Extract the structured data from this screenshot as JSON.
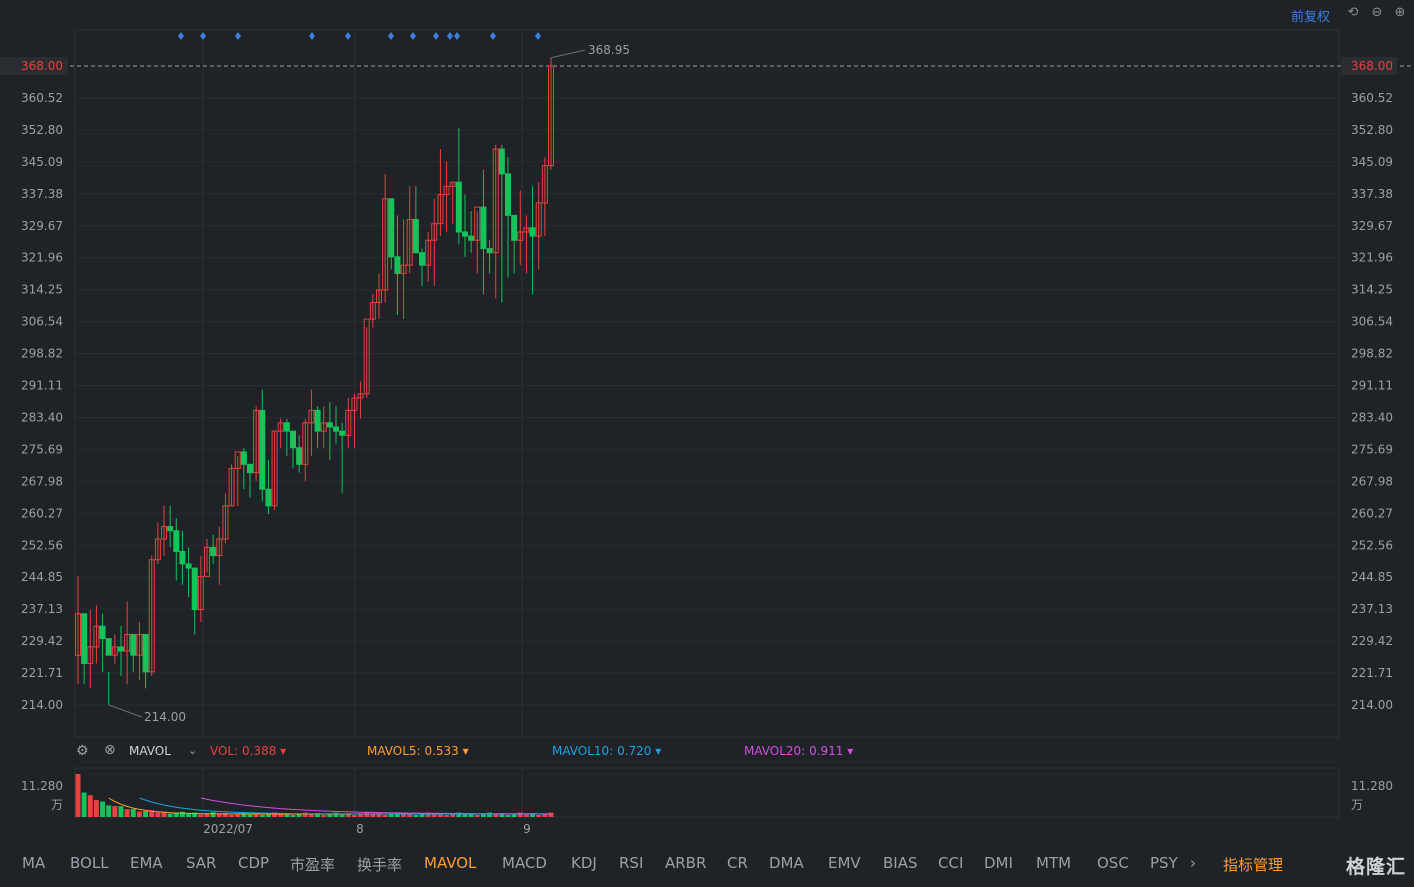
{
  "header": {
    "rehab_label": "前复权",
    "icons": [
      "reset-icon",
      "zoom-out-icon",
      "zoom-in-icon"
    ]
  },
  "price_chart": {
    "price_ticks": [
      "368.00",
      "360.52",
      "352.80",
      "345.09",
      "337.38",
      "329.67",
      "321.96",
      "314.25",
      "306.54",
      "298.82",
      "291.11",
      "283.40",
      "275.69",
      "267.98",
      "260.27",
      "252.56",
      "244.85",
      "237.13",
      "229.42",
      "221.71",
      "214.00"
    ],
    "current_price": "368.00",
    "high_label": "368.95",
    "low_label": "214.00",
    "date_labels": [
      "2022/07",
      "8",
      "9"
    ],
    "colors": {
      "up": "#e8423f",
      "down": "#16c25a",
      "current": "#e8423f",
      "marker": "#3d7fe0"
    },
    "candles": [
      [
        226,
        245,
        219,
        236
      ],
      [
        236,
        232,
        219,
        224
      ],
      [
        224,
        237,
        218,
        228
      ],
      [
        228,
        238,
        224,
        233
      ],
      [
        233,
        236,
        222,
        230
      ],
      [
        230,
        222,
        214,
        226
      ],
      [
        226,
        231,
        224,
        228
      ],
      [
        228,
        233,
        221,
        227
      ],
      [
        227,
        239,
        219,
        231
      ],
      [
        231,
        228,
        222,
        226
      ],
      [
        226,
        234,
        220,
        231
      ],
      [
        231,
        222,
        218,
        222
      ],
      [
        222,
        250,
        221,
        249
      ],
      [
        249,
        258,
        248,
        254
      ],
      [
        254,
        262,
        250,
        257
      ],
      [
        257,
        262,
        252,
        256
      ],
      [
        256,
        259,
        244,
        251
      ],
      [
        251,
        256,
        243,
        248
      ],
      [
        248,
        252,
        240,
        247
      ],
      [
        247,
        241,
        231,
        237
      ],
      [
        237,
        250,
        234,
        245
      ],
      [
        245,
        254,
        246,
        252
      ],
      [
        252,
        255,
        248,
        250
      ],
      [
        250,
        257,
        243,
        254
      ],
      [
        254,
        265,
        253,
        262
      ],
      [
        262,
        272,
        262,
        271
      ],
      [
        271,
        274,
        262,
        275
      ],
      [
        275,
        276,
        266,
        272
      ],
      [
        272,
        272,
        264,
        270
      ],
      [
        270,
        286,
        268,
        285
      ],
      [
        285,
        290,
        263,
        266
      ],
      [
        266,
        273,
        260,
        262
      ],
      [
        262,
        280,
        261,
        280
      ],
      [
        280,
        283,
        276,
        282
      ],
      [
        282,
        283,
        274,
        280
      ],
      [
        280,
        280,
        271,
        276
      ],
      [
        276,
        279,
        270,
        272
      ],
      [
        272,
        283,
        268,
        282
      ],
      [
        282,
        290,
        274,
        285
      ],
      [
        285,
        286,
        276,
        280
      ],
      [
        280,
        286,
        276,
        282
      ],
      [
        282,
        287,
        273,
        281
      ],
      [
        281,
        286,
        277,
        280
      ],
      [
        280,
        282,
        265,
        279
      ],
      [
        279,
        288,
        276,
        285
      ],
      [
        285,
        289,
        276,
        288
      ],
      [
        288,
        292,
        283,
        289
      ],
      [
        289,
        305,
        288,
        307
      ],
      [
        307,
        313,
        305,
        311
      ],
      [
        311,
        318,
        307,
        314
      ],
      [
        314,
        342,
        311,
        336
      ],
      [
        336,
        335,
        319,
        322
      ],
      [
        322,
        332,
        308,
        318
      ],
      [
        318,
        331,
        307,
        320
      ],
      [
        320,
        339,
        318,
        331
      ],
      [
        331,
        339,
        326,
        323
      ],
      [
        323,
        324,
        315,
        320
      ],
      [
        320,
        328,
        316,
        326
      ],
      [
        326,
        336,
        315,
        330
      ],
      [
        330,
        348,
        327,
        337
      ],
      [
        337,
        345,
        328,
        339
      ],
      [
        339,
        340,
        330,
        340
      ],
      [
        340,
        353,
        325,
        328
      ],
      [
        328,
        337,
        322,
        327
      ],
      [
        327,
        333,
        323,
        326
      ],
      [
        326,
        333,
        318,
        334
      ],
      [
        334,
        343,
        313,
        324
      ],
      [
        324,
        326,
        318,
        323
      ],
      [
        323,
        349,
        312,
        348
      ],
      [
        348,
        349,
        311,
        342
      ],
      [
        342,
        346,
        317,
        332
      ],
      [
        332,
        331,
        318,
        326
      ],
      [
        326,
        338,
        320,
        328
      ],
      [
        328,
        332,
        318,
        329
      ],
      [
        329,
        339,
        313,
        327
      ],
      [
        327,
        340,
        319,
        335
      ],
      [
        335,
        346,
        327,
        344
      ],
      [
        344,
        370,
        343,
        368
      ]
    ]
  },
  "volume_panel": {
    "indicator": "MAVOL",
    "vol_label": "VOL:",
    "vol_value": "0.388",
    "ma5_label": "MAVOL5:",
    "ma5_value": "0.533",
    "ma10_label": "MAVOL10:",
    "ma10_value": "0.720",
    "ma20_label": "MAVOL20:",
    "ma20_value": "0.911",
    "max_value": "11.280",
    "unit": "万",
    "colors": {
      "vol": "#e8423f",
      "ma5": "#ff9d2e",
      "ma10": "#1aa3e0",
      "ma20": "#d64fe0"
    }
  },
  "bottom_tabs": [
    {
      "label": "MA",
      "active": false
    },
    {
      "label": "BOLL",
      "active": false
    },
    {
      "label": "EMA",
      "active": false
    },
    {
      "label": "SAR",
      "active": false
    },
    {
      "label": "CDP",
      "active": false
    },
    {
      "label": "市盈率",
      "active": false
    },
    {
      "label": "换手率",
      "active": false
    },
    {
      "label": "MAVOL",
      "active": true
    },
    {
      "label": "MACD",
      "active": false
    },
    {
      "label": "KDJ",
      "active": false
    },
    {
      "label": "RSI",
      "active": false
    },
    {
      "label": "ARBR",
      "active": false
    },
    {
      "label": "CR",
      "active": false
    },
    {
      "label": "DMA",
      "active": false
    },
    {
      "label": "EMV",
      "active": false
    },
    {
      "label": "BIAS",
      "active": false
    },
    {
      "label": "CCI",
      "active": false
    },
    {
      "label": "DMI",
      "active": false
    },
    {
      "label": "MTM",
      "active": false
    },
    {
      "label": "OSC",
      "active": false
    },
    {
      "label": "PSY",
      "active": false
    }
  ],
  "indicator_manage": "指标管理",
  "logo_text": "格隆汇"
}
